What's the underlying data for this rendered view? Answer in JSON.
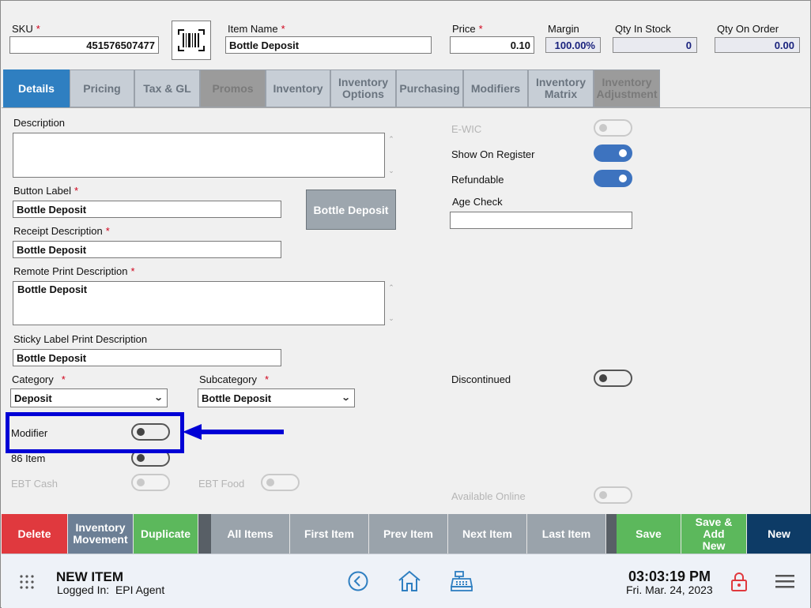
{
  "header": {
    "sku": {
      "label": "SKU",
      "value": "451576507477"
    },
    "item_name": {
      "label": "Item Name",
      "value": "Bottle Deposit"
    },
    "price": {
      "label": "Price",
      "value": "0.10"
    },
    "margin": {
      "label": "Margin",
      "value": "100.00%"
    },
    "qty_in_stock": {
      "label": "Qty In Stock",
      "value": "0"
    },
    "qty_on_order": {
      "label": "Qty On Order",
      "value": "0.00"
    },
    "required_mark": "*"
  },
  "tabs": [
    {
      "label": "Details",
      "state": "active"
    },
    {
      "label": "Pricing",
      "state": "normal"
    },
    {
      "label": "Tax & GL",
      "state": "normal"
    },
    {
      "label": "Promos",
      "state": "disabled"
    },
    {
      "label": "Inventory",
      "state": "normal"
    },
    {
      "label": "Inventory Options",
      "state": "normal"
    },
    {
      "label": "Purchasing",
      "state": "normal"
    },
    {
      "label": "Modifiers",
      "state": "normal"
    },
    {
      "label": "Inventory Matrix",
      "state": "normal"
    },
    {
      "label": "Inventory Adjustment",
      "state": "disabled"
    }
  ],
  "details": {
    "description": {
      "label": "Description",
      "value": ""
    },
    "button_label": {
      "label": "Button Label",
      "value": "Bottle Deposit"
    },
    "button_preview": "Bottle Deposit",
    "receipt_description": {
      "label": "Receipt Description",
      "value": "Bottle Deposit"
    },
    "remote_print_description": {
      "label": "Remote Print Description",
      "value": "Bottle Deposit"
    },
    "sticky_label_print_description": {
      "label": "Sticky Label Print Description",
      "value": "Bottle Deposit"
    },
    "category": {
      "label": "Category",
      "value": "Deposit"
    },
    "subcategory": {
      "label": "Subcategory",
      "value": "Bottle Deposit"
    },
    "toggles_left": {
      "modifier": {
        "label": "Modifier",
        "on": false
      },
      "item_86": {
        "label": "86 Item",
        "on": false
      },
      "ebt_cash": {
        "label": "EBT Cash",
        "on": false,
        "disabled": true
      },
      "ebt_food": {
        "label": "EBT Food",
        "on": false,
        "disabled": true
      }
    },
    "toggles_right": {
      "ewic": {
        "label": "E-WIC",
        "on": false,
        "disabled": true
      },
      "show_on_register": {
        "label": "Show On Register",
        "on": true
      },
      "refundable": {
        "label": "Refundable",
        "on": true
      },
      "discontinued": {
        "label": "Discontinued",
        "on": false
      },
      "available_online": {
        "label": "Available Online",
        "on": false,
        "disabled": true
      }
    },
    "age_check": {
      "label": "Age Check",
      "value": ""
    }
  },
  "actions": {
    "delete": "Delete",
    "inventory_movement": "Inventory Movement",
    "duplicate": "Duplicate",
    "all_items": "All Items",
    "first_item": "First Item",
    "prev_item": "Prev Item",
    "next_item": "Next Item",
    "last_item": "Last Item",
    "save": "Save",
    "save_add_new": "Save & Add New",
    "new": "New"
  },
  "footer": {
    "title": "NEW ITEM",
    "logged_in_label": "Logged In:",
    "user": "EPI Agent",
    "time": "03:03:19 PM",
    "date": "Fri. Mar. 24, 2023"
  },
  "colors": {
    "accent": "#2f7fc1",
    "highlight_annotation": "#0000d6",
    "save_green": "#5cb85c",
    "delete_red": "#e0393e",
    "new_navy": "#0d3b66"
  },
  "icons": [
    "barcode-icon",
    "apps-grid-icon",
    "back-arrow-icon",
    "home-icon",
    "cash-register-icon",
    "lock-icon",
    "menu-icon",
    "chevron-down-icon"
  ]
}
